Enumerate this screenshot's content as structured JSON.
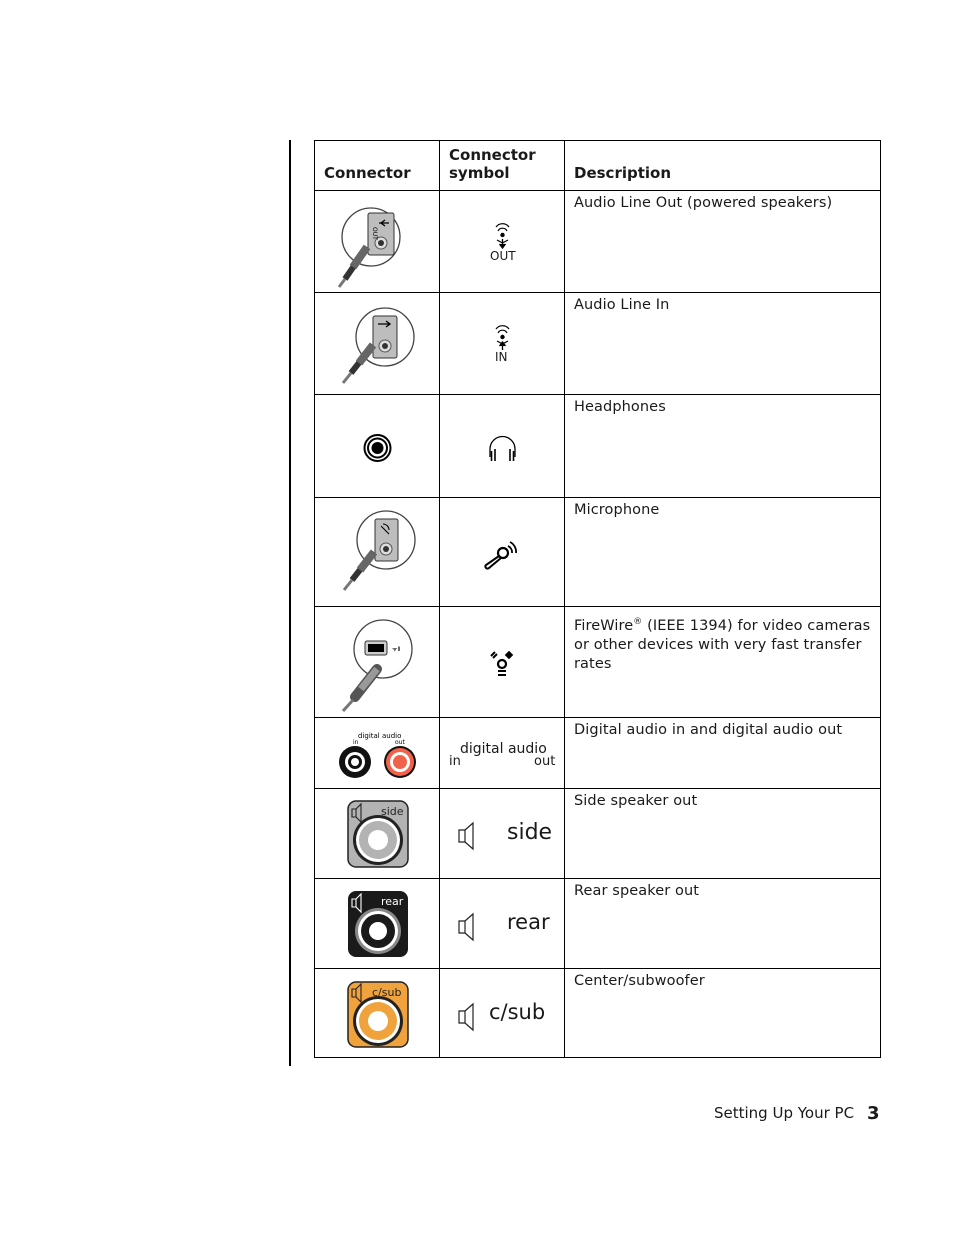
{
  "table": {
    "headers": {
      "connector": "Connector",
      "connector_symbol": "Connector symbol",
      "description": "Description"
    },
    "rows": [
      {
        "connector_icon": "audio-line-out-jack-icon",
        "symbol_icon": "audio-out-symbol-icon",
        "symbol_text": "OUT",
        "description": "Audio Line Out (powered speakers)"
      },
      {
        "connector_icon": "audio-line-in-jack-icon",
        "symbol_icon": "audio-in-symbol-icon",
        "symbol_text": "IN",
        "description": "Audio Line In"
      },
      {
        "connector_icon": "headphone-jack-icon",
        "symbol_icon": "headphones-icon",
        "description": "Headphones"
      },
      {
        "connector_icon": "microphone-jack-icon",
        "symbol_icon": "microphone-icon",
        "description": "Microphone"
      },
      {
        "connector_icon": "firewire-port-icon",
        "symbol_icon": "firewire-icon",
        "description_main": "FireWire",
        "description_sup": "®",
        "description_rest": " (IEEE 1394) for video cameras or other devices with very fast transfer rates"
      },
      {
        "connector_icon": "digital-audio-jacks-icon",
        "connector_label_top": "digital audio",
        "connector_label_in": "in",
        "connector_label_out": "out",
        "symbol_main": "digital audio",
        "symbol_in": "in",
        "symbol_out": "out",
        "description": "Digital audio in and digital audio out"
      },
      {
        "connector_icon": "side-speaker-jack-icon",
        "connector_label": "side",
        "symbol_icon": "speaker-icon",
        "symbol_text": "side",
        "description": "Side speaker out",
        "color": "#b3b3b3"
      },
      {
        "connector_icon": "rear-speaker-jack-icon",
        "connector_label": "rear",
        "symbol_icon": "speaker-icon",
        "symbol_text": "rear",
        "description": "Rear speaker out",
        "color": "#1a1a1a"
      },
      {
        "connector_icon": "center-subwoofer-jack-icon",
        "connector_label": "c/sub",
        "symbol_icon": "speaker-icon",
        "symbol_text": "c/sub",
        "description": "Center/subwoofer",
        "color": "#f0a23c"
      }
    ]
  },
  "footer": {
    "section_title": "Setting Up Your PC",
    "page_number": "3"
  },
  "colors": {
    "digital_out": "#f0624a",
    "side": "#b3b3b3",
    "rear": "#1a1a1a",
    "csub": "#f0a23c"
  }
}
